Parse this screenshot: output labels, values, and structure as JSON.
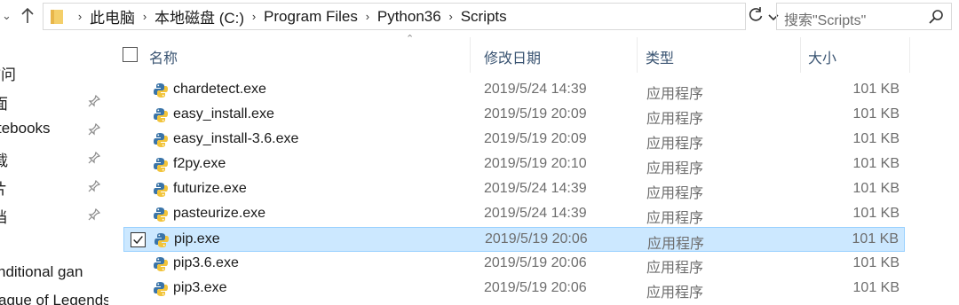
{
  "address": {
    "crumbs": [
      "此电脑",
      "本地磁盘 (C:)",
      "Program Files",
      "Python36",
      "Scripts"
    ],
    "search_placeholder": "搜索\"Scripts\""
  },
  "nav": {
    "items": [
      {
        "label": "访问",
        "pinned": false
      },
      {
        "label": "面",
        "pinned": true
      },
      {
        "label": "tebooks",
        "pinned": true
      },
      {
        "label": "载",
        "pinned": true
      },
      {
        "label": "片",
        "pinned": true
      },
      {
        "label": "档",
        "pinned": true
      },
      {
        "label": "nditional gan",
        "pinned": false
      },
      {
        "label": "ague of Legends",
        "pinned": false
      }
    ]
  },
  "columns": {
    "name": "名称",
    "date": "修改日期",
    "type": "类型",
    "size": "大小"
  },
  "files": [
    {
      "name": "chardetect.exe",
      "date": "2019/5/24 14:39",
      "type": "应用程序",
      "size": "101 KB",
      "selected": false
    },
    {
      "name": "easy_install.exe",
      "date": "2019/5/19 20:09",
      "type": "应用程序",
      "size": "101 KB",
      "selected": false
    },
    {
      "name": "easy_install-3.6.exe",
      "date": "2019/5/19 20:09",
      "type": "应用程序",
      "size": "101 KB",
      "selected": false
    },
    {
      "name": "f2py.exe",
      "date": "2019/5/19 20:10",
      "type": "应用程序",
      "size": "101 KB",
      "selected": false
    },
    {
      "name": "futurize.exe",
      "date": "2019/5/24 14:39",
      "type": "应用程序",
      "size": "101 KB",
      "selected": false
    },
    {
      "name": "pasteurize.exe",
      "date": "2019/5/24 14:39",
      "type": "应用程序",
      "size": "101 KB",
      "selected": false
    },
    {
      "name": "pip.exe",
      "date": "2019/5/19 20:06",
      "type": "应用程序",
      "size": "101 KB",
      "selected": true
    },
    {
      "name": "pip3.6.exe",
      "date": "2019/5/19 20:06",
      "type": "应用程序",
      "size": "101 KB",
      "selected": false
    },
    {
      "name": "pip3.exe",
      "date": "2019/5/19 20:06",
      "type": "应用程序",
      "size": "101 KB",
      "selected": false
    }
  ],
  "colors": {
    "selection_bg": "#cce8ff",
    "selection_border": "#99d1ff",
    "header_text": "#3a5472",
    "secondary_text": "#6d6d6d"
  }
}
